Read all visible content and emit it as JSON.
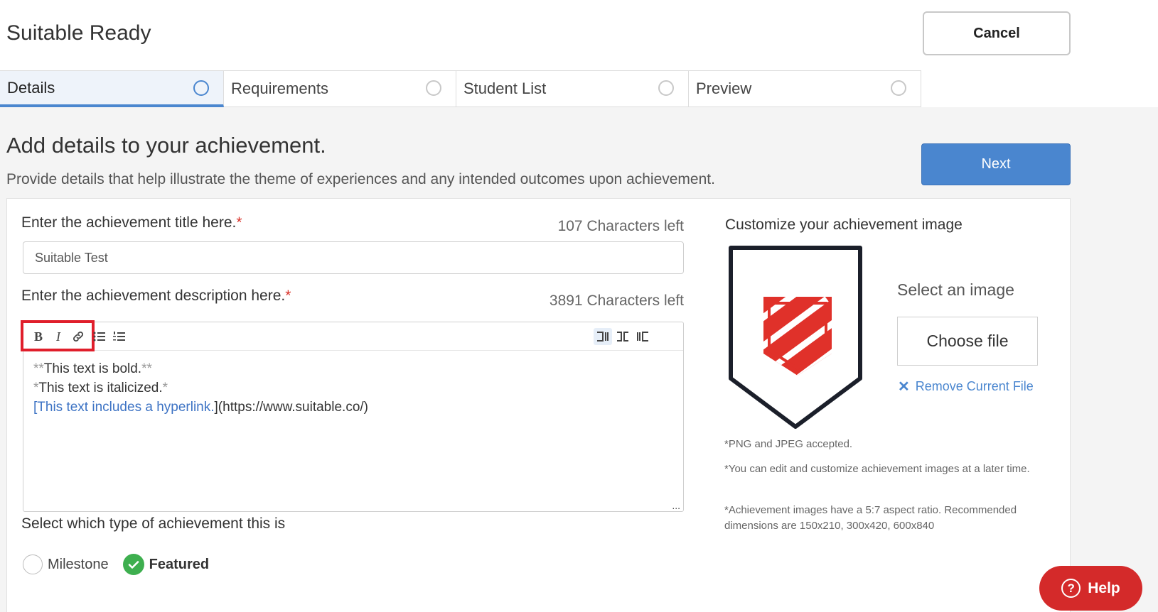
{
  "header": {
    "title": "Suitable Ready",
    "cancel_label": "Cancel"
  },
  "tabs": [
    {
      "label": "Details"
    },
    {
      "label": "Requirements"
    },
    {
      "label": "Student List"
    },
    {
      "label": "Preview"
    }
  ],
  "page": {
    "heading": "Add details to your achievement.",
    "subheading": "Provide details that help illustrate the theme of experiences and any intended outcomes upon achievement.",
    "next_label": "Next"
  },
  "title_field": {
    "label": "Enter the achievement title here.",
    "required_mark": "*",
    "chars_left": "107 Characters left",
    "value": "Suitable Test"
  },
  "description_field": {
    "label": "Enter the achievement description here.",
    "required_mark": "*",
    "chars_left": "3891 Characters left",
    "toolbar": {
      "bold": "B",
      "italic": "I"
    },
    "lines": {
      "line1_mark_open": "**",
      "line1_text": "This text is bold.",
      "line1_mark_close": "**",
      "line2_mark_open": "*",
      "line2_text": "This text is italicized.",
      "line2_mark_close": "*",
      "line3_bracket_open": "[",
      "line3_link_text": "This text includes a hyperlink.",
      "line3_bracket_close": "]",
      "line3_url": "(https://www.suitable.co/)"
    }
  },
  "achievement_type": {
    "label": "Select which type of achievement this is",
    "options": [
      {
        "label": "Milestone",
        "selected": false
      },
      {
        "label": "Featured",
        "selected": true
      }
    ]
  },
  "image_panel": {
    "label": "Customize your achievement image",
    "select_label": "Select an image",
    "choose_file_label": "Choose file",
    "remove_label": "Remove Current File",
    "notes": [
      "*PNG and JPEG accepted.",
      "*You can edit and customize achievement images at a later time.",
      "*Achievement images have a 5:7 aspect ratio. Recommended dimensions are 150x210, 300x420, 600x840"
    ]
  },
  "help": {
    "label": "Help"
  },
  "colors": {
    "accent": "#4a86cf",
    "danger": "#d42a2a",
    "success": "#3eaf4f",
    "badge_red": "#e0312a"
  }
}
